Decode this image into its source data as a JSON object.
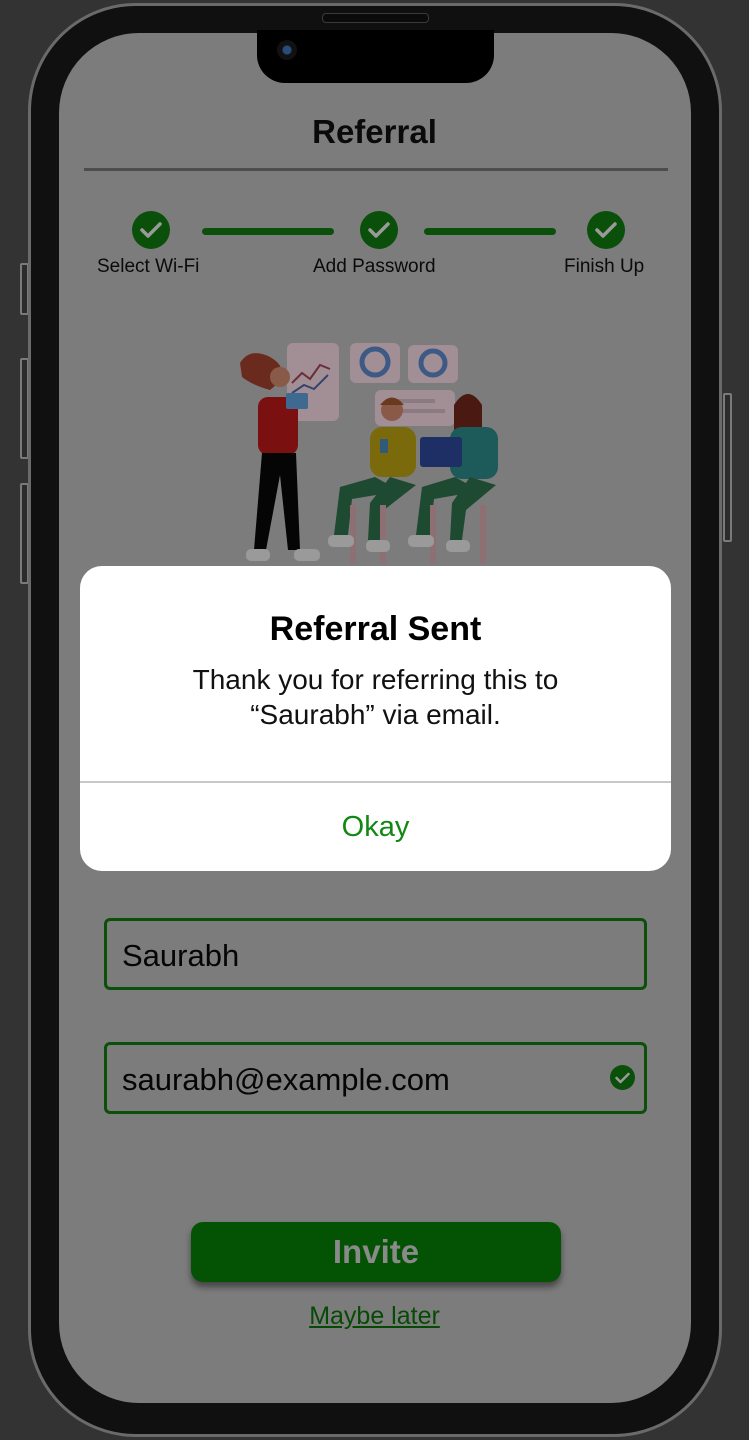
{
  "header": {
    "title": "Referral"
  },
  "stepper": {
    "steps": [
      {
        "label": "Select Wi-Fi",
        "icon": "check-icon",
        "status": "complete"
      },
      {
        "label": "Add Password",
        "icon": "check-icon",
        "status": "complete"
      },
      {
        "label": "Finish Up",
        "icon": "check-icon",
        "status": "complete"
      }
    ]
  },
  "modal": {
    "title": "Referral Sent",
    "message_line1": "Thank you for referring this to",
    "message_line2": "“Saurabh” via email.",
    "ok_label": "Okay"
  },
  "form": {
    "name_value": "Saurabh",
    "email_value": "saurabh@example.com",
    "email_valid_icon": "check-circle-icon"
  },
  "actions": {
    "invite_label": "Invite",
    "maybe_later_label": "Maybe later"
  },
  "colors": {
    "accent_green": "#0a4f0a",
    "ok_green": "#118811",
    "overlay_gray": "#7c7c7c",
    "modal_bg": "#ffffff"
  }
}
